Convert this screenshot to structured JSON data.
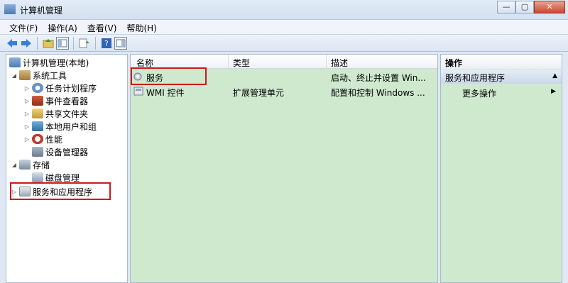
{
  "window": {
    "title": "计算机管理",
    "buttons": {
      "minimize": "—",
      "maximize": "▢",
      "close": "✕"
    }
  },
  "menu": [
    "文件(F)",
    "操作(A)",
    "查看(V)",
    "帮助(H)"
  ],
  "toolbar": {
    "icons": [
      "back-icon",
      "forward-icon",
      "up-icon",
      "show-tree-icon",
      "export-icon",
      "help-icon",
      "properties-icon"
    ]
  },
  "tree": {
    "root": "计算机管理(本地)",
    "items": [
      {
        "label": "系统工具",
        "arrow": "◢",
        "icon": "tools-icon"
      },
      {
        "label": "任务计划程序",
        "arrow": "▷",
        "icon": "task-scheduler-icon"
      },
      {
        "label": "事件查看器",
        "arrow": "▷",
        "icon": "event-viewer-icon"
      },
      {
        "label": "共享文件夹",
        "arrow": "▷",
        "icon": "shared-folder-icon"
      },
      {
        "label": "本地用户和组",
        "arrow": "▷",
        "icon": "users-icon"
      },
      {
        "label": "性能",
        "arrow": "▷",
        "icon": "performance-icon"
      },
      {
        "label": "设备管理器",
        "arrow": "",
        "icon": "device-manager-icon"
      },
      {
        "label": "存储",
        "arrow": "◢",
        "icon": "storage-icon"
      },
      {
        "label": "磁盘管理",
        "arrow": "",
        "icon": "disk-icon"
      },
      {
        "label": "服务和应用程序",
        "arrow": "▷",
        "icon": "services-apps-icon"
      }
    ]
  },
  "list": {
    "columns": [
      "名称",
      "类型",
      "描述"
    ],
    "rows": [
      {
        "name": "服务",
        "type": "",
        "desc": "启动、终止并设置 Win..."
      },
      {
        "name": "WMI 控件",
        "type": "扩展管理单元",
        "desc": "配置和控制 Windows ..."
      }
    ]
  },
  "actions": {
    "title": "操作",
    "section": "服务和应用程序",
    "item": "更多操作",
    "up_glyph": "▲",
    "right_glyph": "▶"
  },
  "colors": {
    "pane_bg": "#cfe9cf",
    "highlight": "#cc1a1a"
  }
}
